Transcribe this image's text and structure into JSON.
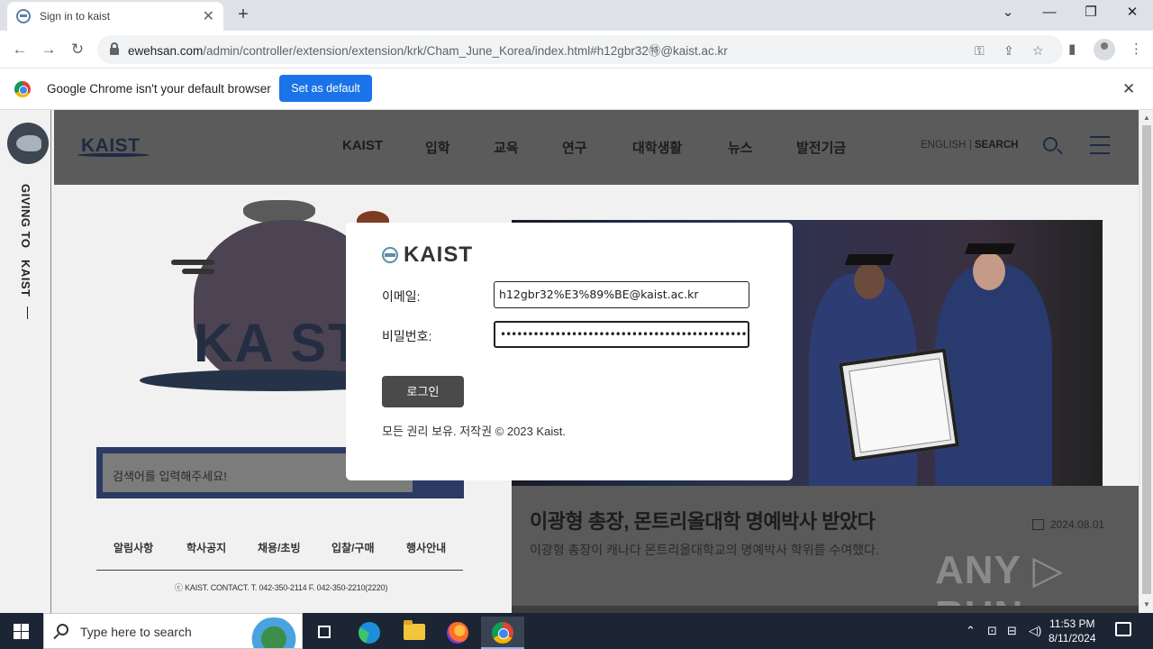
{
  "browser": {
    "tab_title": "Sign in to kaist",
    "url_host": "ewehsan.com",
    "url_path": "/admin/controller/extension/extension/krk/Cham_June_Korea/index.html#h12gbr32㊕@kaist.ac.kr",
    "infobar_text": "Google Chrome isn't your default browser",
    "set_default_label": "Set as default"
  },
  "site": {
    "logo": "KAIST",
    "giving_text": "GIVING TO",
    "giving_kaist": "KAIST",
    "nav": [
      "KAIST",
      "입학",
      "교육",
      "연구",
      "대학생활",
      "뉴스",
      "발전기금"
    ],
    "english": "ENGLISH",
    "search_label": "SEARCH",
    "bag_text": "KA ST",
    "search_placeholder": "검색어를 입력해주세요!",
    "footer_links": [
      "알림사항",
      "학사공지",
      "채용/초빙",
      "입찰/구매",
      "행사안내"
    ],
    "contact": "ⓒ KAIST. CONTACT. T. 042-350-2114 F. 042-350-2210(2220)",
    "news_title": "이광형 총장, 몬트리올대학 명예박사 받았다",
    "news_date": "2024.08.01",
    "news_desc": "이광형 총장이 캐나다 몬트리올대학교의 명예박사 학위를 수여했다.",
    "watermark": "ANY ▷ RUN"
  },
  "modal": {
    "logo_text": "KAIST",
    "email_label": "이메일:",
    "email_value": "h12gbr32%E3%89%BE@kaist.ac.kr",
    "password_label": "비밀번호:",
    "password_value": "••••••••••••••••••••••••••••••••••••••••••••••••••••••",
    "login_label": "로그인",
    "copyright": "모든 권리 보유. 저작권 © 2023 Kaist."
  },
  "taskbar": {
    "search_placeholder": "Type here to search",
    "time": "11:53 PM",
    "date": "8/11/2024"
  }
}
